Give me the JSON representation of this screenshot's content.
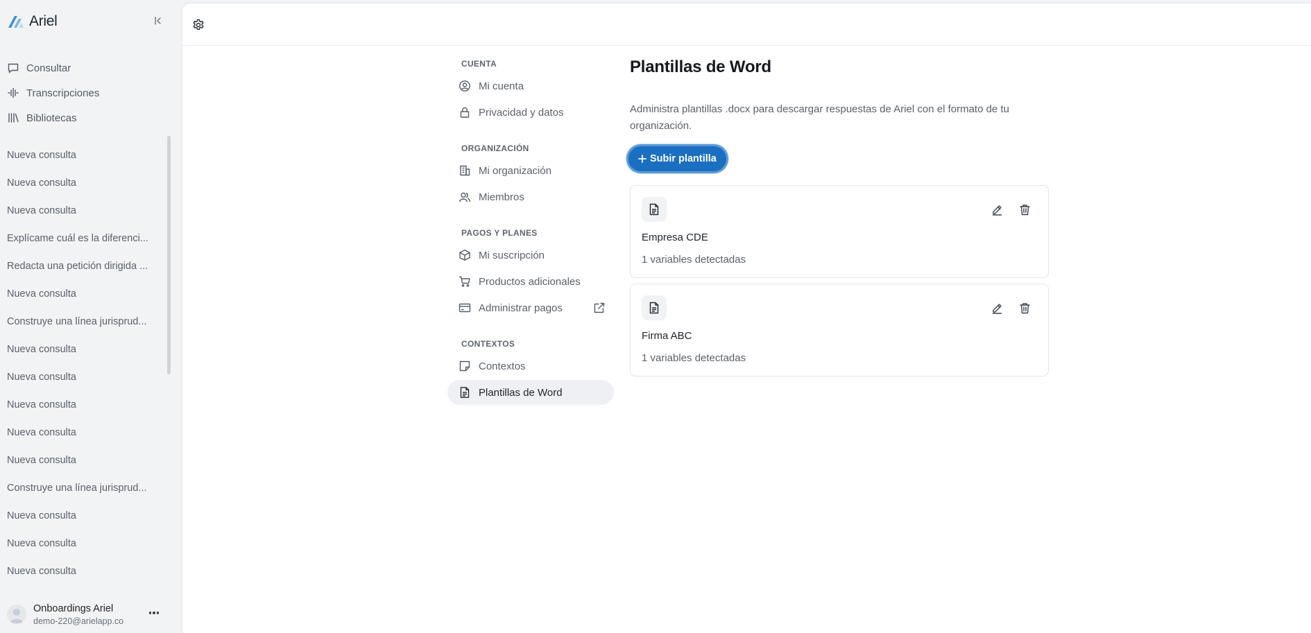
{
  "app": {
    "name": "Ariel",
    "accent": "#1b6fc0"
  },
  "sidebar": {
    "nav": [
      {
        "label": "Consultar",
        "icon": "chat-icon"
      },
      {
        "label": "Transcripciones",
        "icon": "waveform-icon"
      },
      {
        "label": "Bibliotecas",
        "icon": "library-icon"
      }
    ],
    "history": [
      "Nueva consulta",
      "Nueva consulta",
      "Nueva consulta",
      "Explícame cuál es la diferenci...",
      "Redacta una petición dirigida ...",
      "Nueva consulta",
      "Construye una línea jurisprud...",
      "Nueva consulta",
      "Nueva consulta",
      "Nueva consulta",
      "Nueva consulta",
      "Nueva consulta",
      "Construye una línea jurisprud...",
      "Nueva consulta",
      "Nueva consulta",
      "Nueva consulta"
    ],
    "user": {
      "name": "Onboardings Ariel",
      "email": "demo-220@arielapp.co"
    }
  },
  "settings_nav": {
    "sections": [
      {
        "label": "CUENTA",
        "items": [
          "Mi cuenta",
          "Privacidad y datos"
        ]
      },
      {
        "label": "ORGANIZACIÓN",
        "items": [
          "Mi organización",
          "Miembros"
        ]
      },
      {
        "label": "PAGOS Y PLANES",
        "items": [
          "Mi suscripción",
          "Productos adicionales",
          "Administrar pagos"
        ]
      },
      {
        "label": "CONTEXTOS",
        "items": [
          "Contextos",
          "Plantillas de Word"
        ]
      }
    ],
    "active": "Plantillas de Word"
  },
  "content": {
    "title": "Plantillas de Word",
    "description": "Administra plantillas .docx para descargar respuestas de Ariel con el formato de tu organización.",
    "upload_label": "Subir plantilla",
    "templates": [
      {
        "name": "Empresa CDE",
        "variables": "1 variables detectadas"
      },
      {
        "name": "Firma ABC",
        "variables": "1 variables detectadas"
      }
    ]
  }
}
